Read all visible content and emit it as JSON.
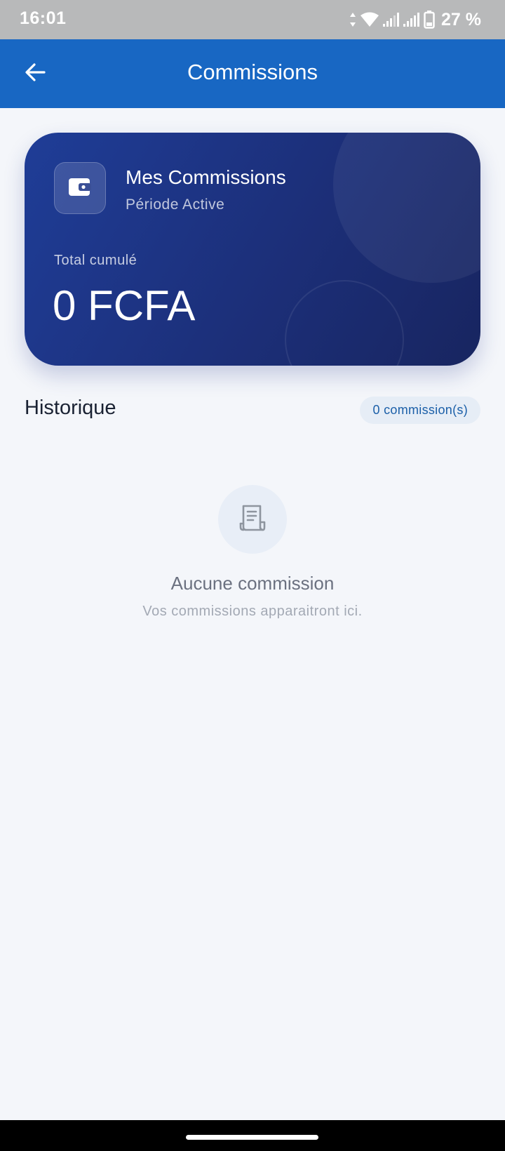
{
  "status_bar": {
    "time": "16:01",
    "battery": "27 %",
    "icons": [
      "data-arrows-icon",
      "wifi-icon",
      "signal-icon",
      "signal-icon",
      "battery-icon"
    ]
  },
  "app_bar": {
    "title": "Commissions",
    "back_icon": "arrow-left-icon",
    "color": "#1867c3"
  },
  "card": {
    "icon": "wallet-icon",
    "title": "Mes Commissions",
    "subtitle": "Période Active",
    "total_label": "Total cumulé",
    "total_value": "0 FCFA"
  },
  "history": {
    "title": "Historique",
    "count_label": "0 commission(s)"
  },
  "empty_state": {
    "icon": "receipt-icon",
    "title": "Aucune commission",
    "text": "Vos commissions apparaitront ici."
  }
}
